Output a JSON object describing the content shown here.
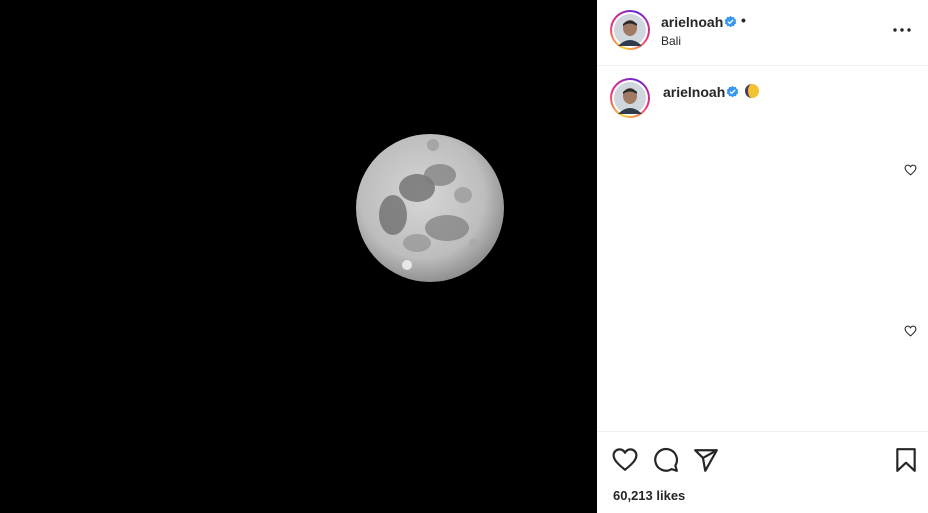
{
  "post": {
    "username": "arielnoah",
    "location": "Bali",
    "separator": "•",
    "likes": "60,213 likes"
  },
  "caption": {
    "username": "arielnoah"
  },
  "icons": {
    "verified": "verified-badge-icon",
    "more": "more-options-icon",
    "like": "heart-icon",
    "comment": "comment-icon",
    "share": "share-icon",
    "save": "bookmark-icon",
    "caption_emoji": "moon-emoji-icon"
  },
  "colors": {
    "verified": "#3897f0",
    "text": "#262626",
    "media_background": "#000000"
  }
}
